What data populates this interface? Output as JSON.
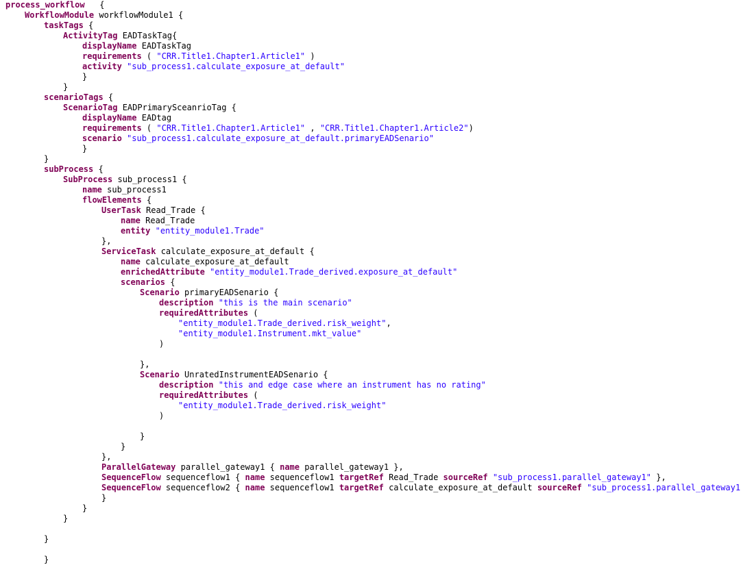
{
  "editor": {
    "colors": {
      "background": "#ffffff",
      "keyword": "#7f0055",
      "string": "#2a00ff",
      "text": "#000000"
    },
    "lines": [
      {
        "indent": 0,
        "tokens": [
          {
            "t": "kw",
            "v": "process_workflow"
          },
          {
            "t": "plain",
            "v": "   {"
          }
        ]
      },
      {
        "indent": 4,
        "tokens": [
          {
            "t": "kw",
            "v": "WorkflowModule"
          },
          {
            "t": "plain",
            "v": " workflowModule1 {"
          }
        ]
      },
      {
        "indent": 8,
        "tokens": [
          {
            "t": "kw",
            "v": "taskTags"
          },
          {
            "t": "plain",
            "v": " {"
          }
        ]
      },
      {
        "indent": 12,
        "tokens": [
          {
            "t": "kw",
            "v": "ActivityTag"
          },
          {
            "t": "plain",
            "v": " EADTaskTag{"
          }
        ]
      },
      {
        "indent": 16,
        "tokens": [
          {
            "t": "kw",
            "v": "displayName"
          },
          {
            "t": "plain",
            "v": " EADTaskTag"
          }
        ]
      },
      {
        "indent": 16,
        "tokens": [
          {
            "t": "kw",
            "v": "requirements"
          },
          {
            "t": "plain",
            "v": " ( "
          },
          {
            "t": "str",
            "v": "\"CRR.Title1.Chapter1.Article1\""
          },
          {
            "t": "plain",
            "v": " )"
          }
        ]
      },
      {
        "indent": 16,
        "tokens": [
          {
            "t": "kw",
            "v": "activity"
          },
          {
            "t": "plain",
            "v": " "
          },
          {
            "t": "str",
            "v": "\"sub_process1.calculate_exposure_at_default\""
          }
        ]
      },
      {
        "indent": 16,
        "tokens": [
          {
            "t": "plain",
            "v": "}"
          }
        ]
      },
      {
        "indent": 12,
        "tokens": [
          {
            "t": "plain",
            "v": "}"
          }
        ]
      },
      {
        "indent": 8,
        "tokens": [
          {
            "t": "kw",
            "v": "scenarioTags"
          },
          {
            "t": "plain",
            "v": " {"
          }
        ]
      },
      {
        "indent": 12,
        "tokens": [
          {
            "t": "kw",
            "v": "ScenarioTag"
          },
          {
            "t": "plain",
            "v": " EADPrimarySceanrioTag {"
          }
        ]
      },
      {
        "indent": 16,
        "tokens": [
          {
            "t": "kw",
            "v": "displayName"
          },
          {
            "t": "plain",
            "v": " EADtag"
          }
        ]
      },
      {
        "indent": 16,
        "tokens": [
          {
            "t": "kw",
            "v": "requirements"
          },
          {
            "t": "plain",
            "v": " ( "
          },
          {
            "t": "str",
            "v": "\"CRR.Title1.Chapter1.Article1\""
          },
          {
            "t": "plain",
            "v": " , "
          },
          {
            "t": "str",
            "v": "\"CRR.Title1.Chapter1.Article2\""
          },
          {
            "t": "plain",
            "v": ")"
          }
        ]
      },
      {
        "indent": 16,
        "tokens": [
          {
            "t": "kw",
            "v": "scenario"
          },
          {
            "t": "plain",
            "v": " "
          },
          {
            "t": "str",
            "v": "\"sub_process1.calculate_exposure_at_default.primaryEADSenario\""
          }
        ]
      },
      {
        "indent": 16,
        "tokens": [
          {
            "t": "plain",
            "v": "}"
          }
        ]
      },
      {
        "indent": 8,
        "tokens": [
          {
            "t": "plain",
            "v": "}"
          }
        ]
      },
      {
        "indent": 8,
        "tokens": [
          {
            "t": "kw",
            "v": "subProcess"
          },
          {
            "t": "plain",
            "v": " {"
          }
        ]
      },
      {
        "indent": 12,
        "tokens": [
          {
            "t": "kw",
            "v": "SubProcess"
          },
          {
            "t": "plain",
            "v": " sub_process1 {"
          }
        ]
      },
      {
        "indent": 16,
        "tokens": [
          {
            "t": "kw",
            "v": "name"
          },
          {
            "t": "plain",
            "v": " sub_process1"
          }
        ]
      },
      {
        "indent": 16,
        "tokens": [
          {
            "t": "kw",
            "v": "flowElements"
          },
          {
            "t": "plain",
            "v": " {"
          }
        ]
      },
      {
        "indent": 20,
        "tokens": [
          {
            "t": "kw",
            "v": "UserTask"
          },
          {
            "t": "plain",
            "v": " Read_Trade {"
          }
        ]
      },
      {
        "indent": 24,
        "tokens": [
          {
            "t": "kw",
            "v": "name"
          },
          {
            "t": "plain",
            "v": " Read_Trade"
          }
        ]
      },
      {
        "indent": 24,
        "tokens": [
          {
            "t": "kw",
            "v": "entity"
          },
          {
            "t": "plain",
            "v": " "
          },
          {
            "t": "str",
            "v": "\"entity_module1.Trade\""
          }
        ]
      },
      {
        "indent": 20,
        "tokens": [
          {
            "t": "plain",
            "v": "},"
          }
        ]
      },
      {
        "indent": 20,
        "tokens": [
          {
            "t": "kw",
            "v": "ServiceTask"
          },
          {
            "t": "plain",
            "v": " calculate_exposure_at_default {"
          }
        ]
      },
      {
        "indent": 24,
        "tokens": [
          {
            "t": "kw",
            "v": "name"
          },
          {
            "t": "plain",
            "v": " calculate_exposure_at_default"
          }
        ]
      },
      {
        "indent": 24,
        "tokens": [
          {
            "t": "kw",
            "v": "enrichedAttribute"
          },
          {
            "t": "plain",
            "v": " "
          },
          {
            "t": "str",
            "v": "\"entity_module1.Trade_derived.exposure_at_default\""
          }
        ]
      },
      {
        "indent": 24,
        "tokens": [
          {
            "t": "kw",
            "v": "scenarios"
          },
          {
            "t": "plain",
            "v": " {"
          }
        ]
      },
      {
        "indent": 28,
        "tokens": [
          {
            "t": "kw",
            "v": "Scenario"
          },
          {
            "t": "plain",
            "v": " primaryEADSenario {"
          }
        ]
      },
      {
        "indent": 32,
        "tokens": [
          {
            "t": "kw",
            "v": "description"
          },
          {
            "t": "plain",
            "v": " "
          },
          {
            "t": "str",
            "v": "\"this is the main scenario\""
          }
        ]
      },
      {
        "indent": 32,
        "tokens": [
          {
            "t": "kw",
            "v": "requiredAttributes"
          },
          {
            "t": "plain",
            "v": " ("
          }
        ]
      },
      {
        "indent": 36,
        "tokens": [
          {
            "t": "str",
            "v": "\"entity_module1.Trade_derived.risk_weight\""
          },
          {
            "t": "plain",
            "v": ","
          }
        ]
      },
      {
        "indent": 36,
        "tokens": [
          {
            "t": "str",
            "v": "\"entity_module1.Instrument.mkt_value\""
          }
        ]
      },
      {
        "indent": 32,
        "tokens": [
          {
            "t": "plain",
            "v": ")"
          }
        ]
      },
      {
        "indent": 0,
        "tokens": []
      },
      {
        "indent": 28,
        "tokens": [
          {
            "t": "plain",
            "v": "},"
          }
        ]
      },
      {
        "indent": 28,
        "tokens": [
          {
            "t": "kw",
            "v": "Scenario"
          },
          {
            "t": "plain",
            "v": " UnratedInstrumentEADSenario {"
          }
        ]
      },
      {
        "indent": 32,
        "tokens": [
          {
            "t": "kw",
            "v": "description"
          },
          {
            "t": "plain",
            "v": " "
          },
          {
            "t": "str",
            "v": "\"this and edge case where an instrument has no rating\""
          }
        ]
      },
      {
        "indent": 32,
        "tokens": [
          {
            "t": "kw",
            "v": "requiredAttributes"
          },
          {
            "t": "plain",
            "v": " ("
          }
        ]
      },
      {
        "indent": 36,
        "tokens": [
          {
            "t": "str",
            "v": "\"entity_module1.Trade_derived.risk_weight\""
          }
        ]
      },
      {
        "indent": 32,
        "tokens": [
          {
            "t": "plain",
            "v": ")"
          }
        ]
      },
      {
        "indent": 0,
        "tokens": []
      },
      {
        "indent": 28,
        "tokens": [
          {
            "t": "plain",
            "v": "}"
          }
        ]
      },
      {
        "indent": 24,
        "tokens": [
          {
            "t": "plain",
            "v": "}"
          }
        ]
      },
      {
        "indent": 20,
        "tokens": [
          {
            "t": "plain",
            "v": "},"
          }
        ]
      },
      {
        "indent": 20,
        "tokens": [
          {
            "t": "kw",
            "v": "ParallelGateway"
          },
          {
            "t": "plain",
            "v": " parallel_gateway1 { "
          },
          {
            "t": "kw",
            "v": "name"
          },
          {
            "t": "plain",
            "v": " parallel_gateway1 },"
          }
        ]
      },
      {
        "indent": 20,
        "tokens": [
          {
            "t": "kw",
            "v": "SequenceFlow"
          },
          {
            "t": "plain",
            "v": " sequenceflow1 { "
          },
          {
            "t": "kw",
            "v": "name"
          },
          {
            "t": "plain",
            "v": " sequenceflow1 "
          },
          {
            "t": "kw",
            "v": "targetRef"
          },
          {
            "t": "plain",
            "v": " Read_Trade "
          },
          {
            "t": "kw",
            "v": "sourceRef"
          },
          {
            "t": "plain",
            "v": " "
          },
          {
            "t": "str",
            "v": "\"sub_process1.parallel_gateway1\""
          },
          {
            "t": "plain",
            "v": " },"
          }
        ]
      },
      {
        "indent": 20,
        "tokens": [
          {
            "t": "kw",
            "v": "SequenceFlow"
          },
          {
            "t": "plain",
            "v": " sequenceflow2 { "
          },
          {
            "t": "kw",
            "v": "name"
          },
          {
            "t": "plain",
            "v": " sequenceflow1 "
          },
          {
            "t": "kw",
            "v": "targetRef"
          },
          {
            "t": "plain",
            "v": " calculate_exposure_at_default "
          },
          {
            "t": "kw",
            "v": "sourceRef"
          },
          {
            "t": "plain",
            "v": " "
          },
          {
            "t": "str",
            "v": "\"sub_process1.parallel_gateway1\""
          },
          {
            "t": "plain",
            "v": " }"
          }
        ]
      },
      {
        "indent": 20,
        "tokens": [
          {
            "t": "plain",
            "v": "}"
          }
        ]
      },
      {
        "indent": 16,
        "tokens": [
          {
            "t": "plain",
            "v": "}"
          }
        ]
      },
      {
        "indent": 12,
        "tokens": [
          {
            "t": "plain",
            "v": "}"
          }
        ]
      },
      {
        "indent": 0,
        "tokens": []
      },
      {
        "indent": 8,
        "tokens": [
          {
            "t": "plain",
            "v": "}"
          }
        ]
      },
      {
        "indent": 0,
        "tokens": []
      },
      {
        "indent": 8,
        "tokens": [
          {
            "t": "plain",
            "v": "}"
          }
        ]
      }
    ]
  }
}
